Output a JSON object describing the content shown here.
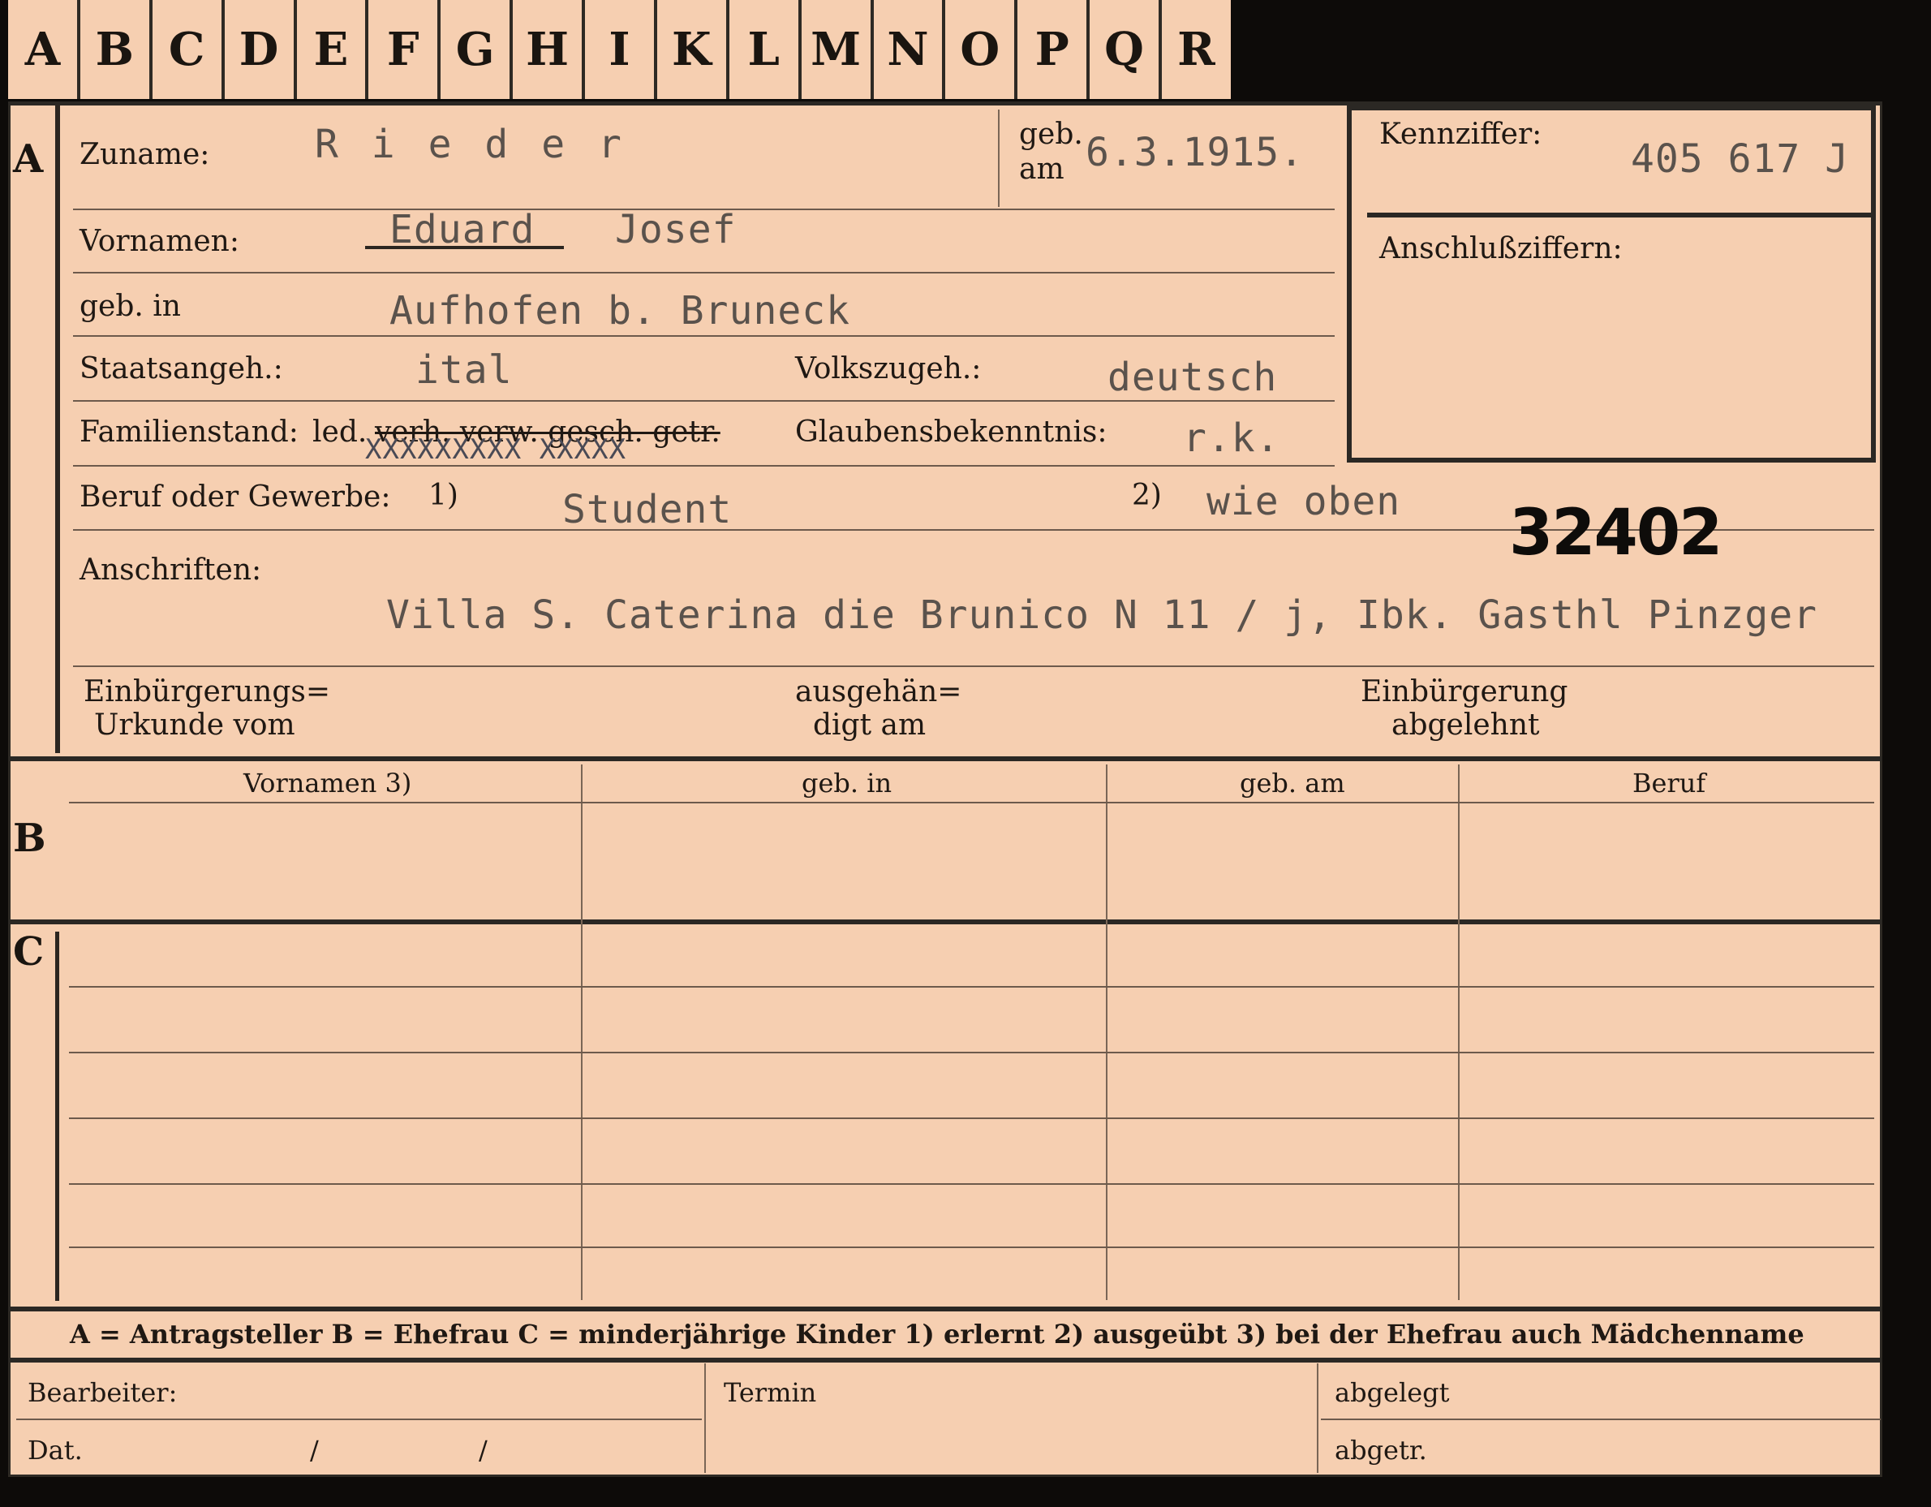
{
  "tabs": [
    "A",
    "B",
    "C",
    "D",
    "E",
    "F",
    "G",
    "H",
    "I",
    "K",
    "L",
    "M",
    "N",
    "O",
    "P",
    "Q",
    "R"
  ],
  "sections": {
    "a": "A",
    "b": "B",
    "c": "C"
  },
  "fields": {
    "zuname_label": "Zuname:",
    "zuname_value": "R i e d e r",
    "geb_am_label_1": "geb.",
    "geb_am_label_2": "am",
    "geb_am_value": "6.3.1915.",
    "kennziffer_label": "Kennziffer:",
    "kennziffer_value": "405 617 J",
    "anschluss_label": "Anschlußziffern:",
    "vornamen_label": "Vornamen:",
    "vornamen_value_1": "Eduard",
    "vornamen_value_2": "Josef",
    "geb_in_label": "geb. in",
    "geb_in_value": "Aufhofen b. Bruneck",
    "staats_label": "Staatsangeh.:",
    "staats_value": "ital",
    "volks_label": "Volkszugeh.:",
    "volks_value": "deutsch",
    "familien_label": "Familienstand:",
    "familien_led": "led.",
    "familien_rest": "verh. verw. gesch. getr.",
    "familien_x": "XXXXXXXXX XXXXX",
    "glauben_label": "Glaubensbekenntnis:",
    "glauben_value": "r.k.",
    "beruf_label": "Beruf oder Gewerbe:",
    "beruf_note1": "1)",
    "beruf_value": "Student",
    "beruf_note2": "2)",
    "beruf_value2": "wie oben",
    "stamp": "32402",
    "anschriften_label": "Anschriften:",
    "anschriften_value": "Villa S. Caterina die Brunico N 11 / j, Ibk. Gasthl Pinzger",
    "einb_label_1": "Einbürgerungs=",
    "einb_label_2": "Urkunde vom",
    "ausg_label_1": "ausgehän=",
    "ausg_label_2": "digt am",
    "abgel_label_1": "Einbürgerung",
    "abgel_label_2": "abgelehnt"
  },
  "table_headers": [
    "Vornamen 3)",
    "geb. in",
    "geb. am",
    "Beruf"
  ],
  "legend": "A = Antragsteller   B = Ehefrau   C = minderjährige Kinder   1) erlernt   2) ausgeübt   3) bei der Ehefrau auch Mädchenname",
  "footer": {
    "bearbeiter": "Bearbeiter:",
    "dat": "Dat.",
    "slash1": "/",
    "slash2": "/",
    "termin": "Termin",
    "abgelegt": "abgelegt",
    "abgetr": "abgetr."
  }
}
